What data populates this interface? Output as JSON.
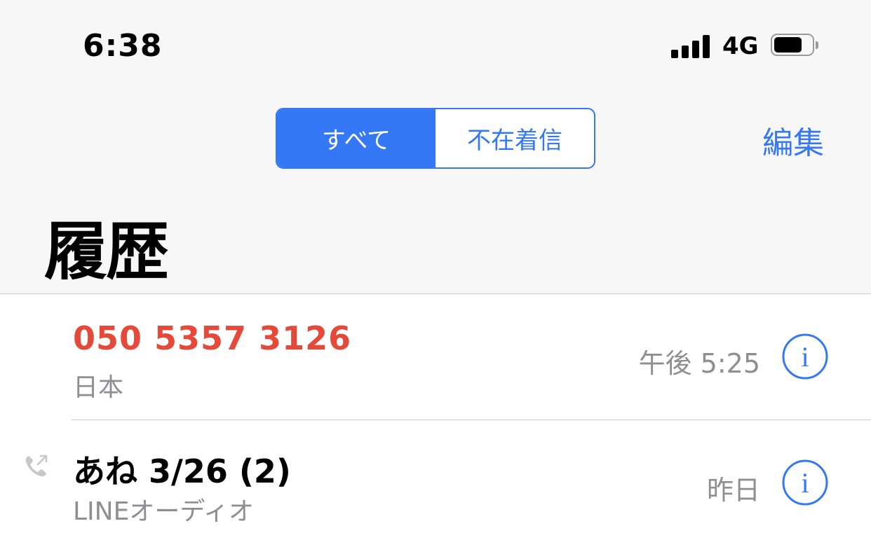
{
  "status_bar": {
    "time": "6:38",
    "network": "4G",
    "signal_bars": 4,
    "battery_level": 0.75
  },
  "segmented_control": {
    "segments": [
      {
        "label": "すべて",
        "selected": true
      },
      {
        "label": "不在着信",
        "selected": false
      }
    ]
  },
  "nav": {
    "edit_label": "編集"
  },
  "page": {
    "title": "履歴"
  },
  "calls": [
    {
      "name": "050 5357 3126",
      "detail": "日本",
      "time": "午後 5:25",
      "missed": true,
      "outgoing": false
    },
    {
      "name": "あね 3/26 (2)",
      "detail": "LINEオーディオ",
      "time": "昨日",
      "missed": false,
      "outgoing": true
    }
  ],
  "colors": {
    "accent": "#3478f6",
    "missed": "#e5493a",
    "secondary_text": "#8e8e93",
    "header_bg": "#f7f7f7",
    "separator": "#c8c7cc"
  },
  "icons": {
    "signal": "cellular-signal-icon",
    "battery": "battery-icon",
    "info": "info-circle-icon",
    "outgoing": "outgoing-call-icon"
  }
}
